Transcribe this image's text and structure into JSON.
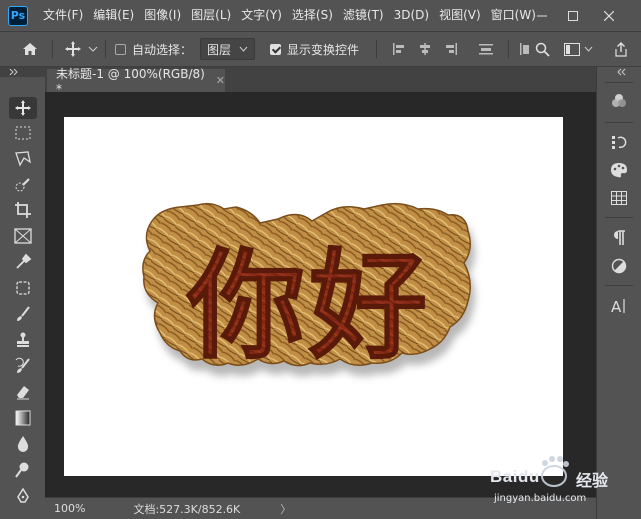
{
  "app": {
    "logo_text": "Ps"
  },
  "menu": [
    "文件(F)",
    "编辑(E)",
    "图像(I)",
    "图层(L)",
    "文字(Y)",
    "选择(S)",
    "滤镜(T)",
    "3D(D)",
    "视图(V)",
    "窗口(W)"
  ],
  "options": {
    "auto_select_label": "自动选择：",
    "auto_select_checked": false,
    "layer_dropdown": "图层",
    "show_transform_label": "显示变换控件",
    "show_transform_checked": true
  },
  "document": {
    "tab_title": "未标题-1 @ 100%(RGB/8) *",
    "canvas_text": "你好"
  },
  "status": {
    "zoom": "100%",
    "doc_info": "文档:527.3K/852.6K",
    "arrow": "〉"
  },
  "right_panel_icons": [
    "color-wheel-icon",
    "history-icon",
    "palette-icon",
    "swatches-grid-icon",
    "paragraph-icon",
    "adjustment-icon",
    "character-icon"
  ],
  "watermark": {
    "brand": "Baidu",
    "brand_cn": "经验",
    "url": "jingyan.baidu.com"
  },
  "colors": {
    "ui_bg": "#535353",
    "workspace_bg": "#282828",
    "text_fill": "#8b2c17",
    "stroke_gold": "#c89a4c"
  }
}
